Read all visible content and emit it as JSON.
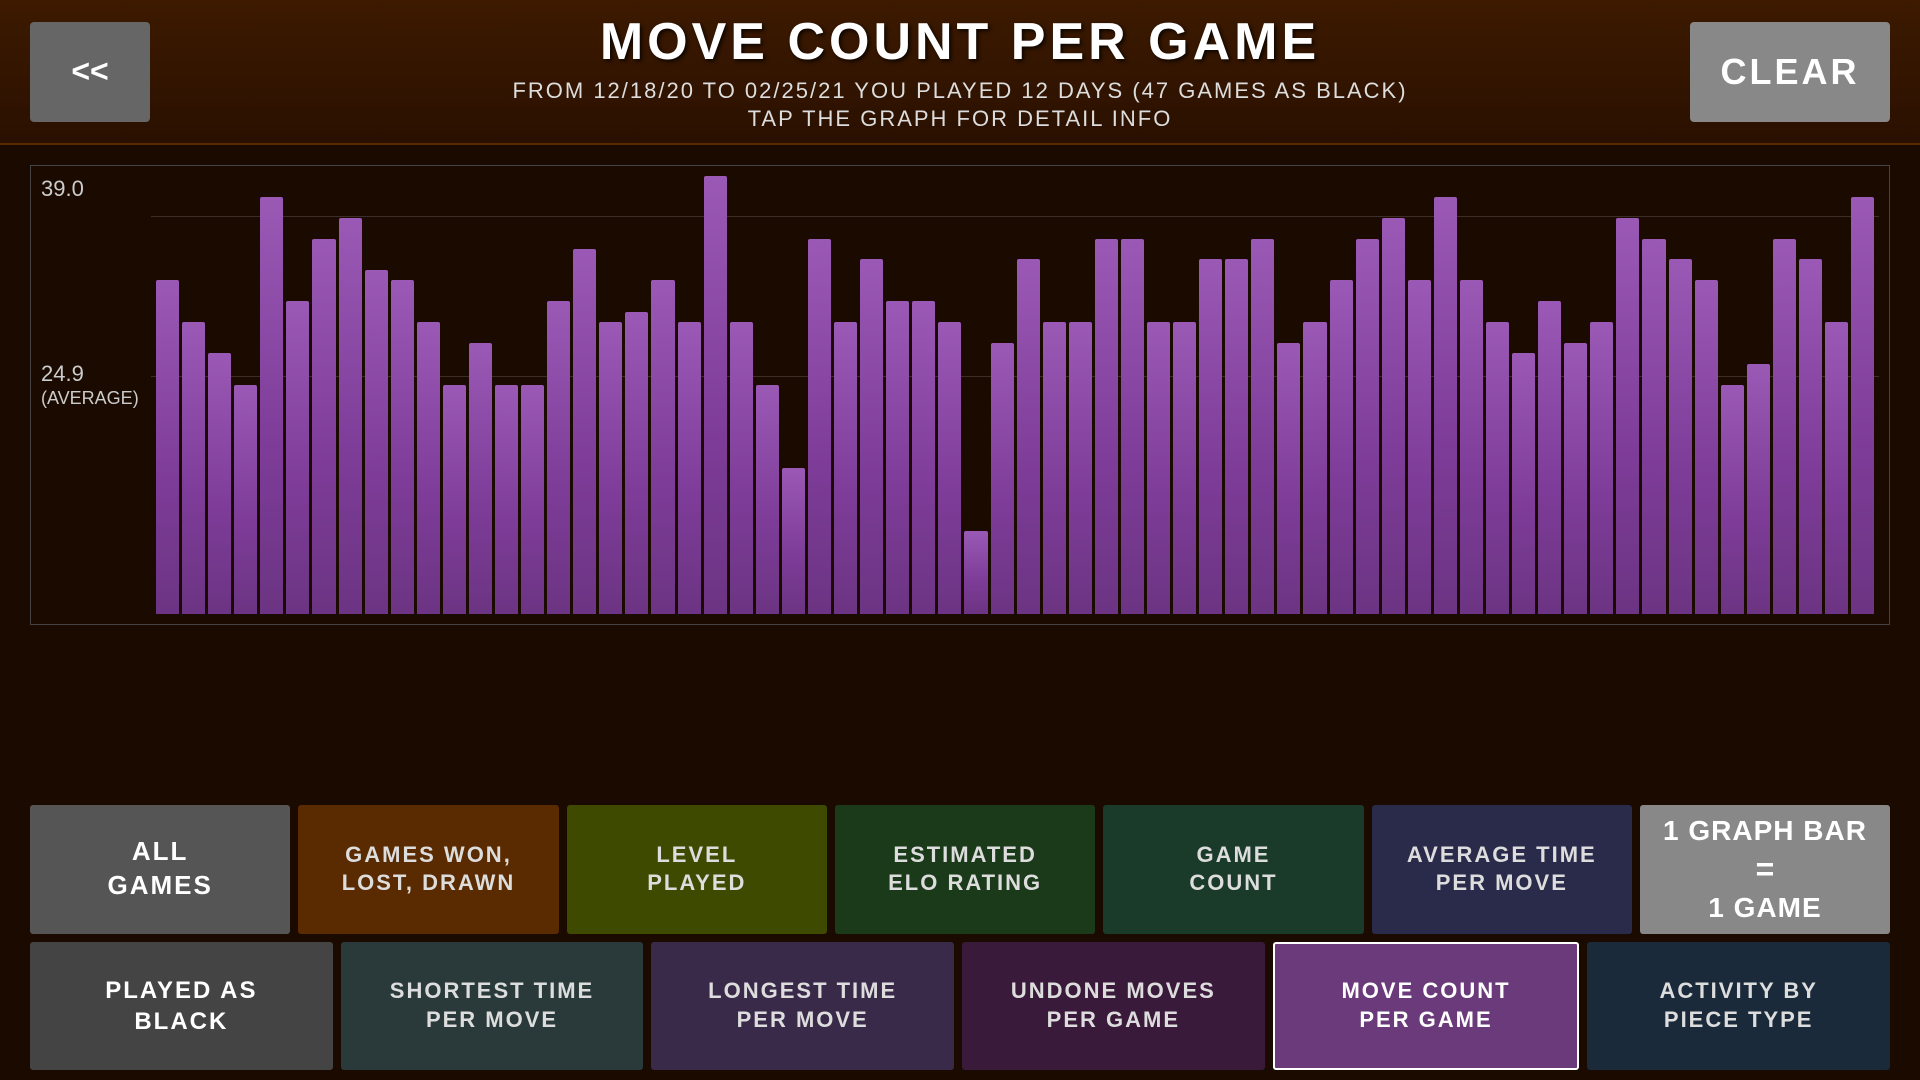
{
  "header": {
    "title": "MOVE COUNT PER GAME",
    "subtitle": "FROM 12/18/20 TO 02/25/21 YOU PLAYED 12 DAYS (47 GAMES AS BLACK)",
    "tap_hint": "TAP THE GRAPH FOR DETAIL INFO",
    "back_label": "<<",
    "clear_label": "CLEAR"
  },
  "chart": {
    "y_max": "39.0",
    "y_avg": "24.9",
    "y_avg_label": "(AVERAGE)",
    "bars": [
      32,
      28,
      25,
      22,
      40,
      30,
      36,
      38,
      33,
      32,
      28,
      22,
      26,
      22,
      22,
      30,
      35,
      28,
      29,
      32,
      28,
      42,
      28,
      22,
      14,
      36,
      28,
      34,
      30,
      30,
      28,
      8,
      26,
      34,
      28,
      28,
      36,
      36,
      28,
      28,
      34,
      34,
      36,
      26,
      28,
      32,
      36,
      38,
      32,
      40,
      32,
      28,
      25,
      30,
      26,
      28,
      38,
      36,
      34,
      32,
      22,
      24,
      36,
      34,
      28,
      40
    ]
  },
  "buttons": {
    "row1": [
      {
        "id": "all-games",
        "label": "ALL\nGAMES",
        "style": "btn-all-games"
      },
      {
        "id": "games-won",
        "label": "GAMES WON,\nLOST, DRAWN",
        "style": "btn-games-won"
      },
      {
        "id": "level-played",
        "label": "LEVEL\nPLAYED",
        "style": "btn-level"
      },
      {
        "id": "estimated-elo",
        "label": "ESTIMATED\nELO RATING",
        "style": "btn-elo"
      },
      {
        "id": "game-count",
        "label": "GAME\nCOUNT",
        "style": "btn-game-count"
      },
      {
        "id": "avg-time",
        "label": "AVERAGE TIME\nPER MOVE",
        "style": "btn-avg-time"
      }
    ],
    "row2": [
      {
        "id": "played-as-black",
        "label": "PLAYED AS\nBLACK",
        "style": "btn-played-as"
      },
      {
        "id": "shortest-time",
        "label": "SHORTEST TIME\nPER MOVE",
        "style": "btn-shortest"
      },
      {
        "id": "longest-time",
        "label": "LONGEST TIME\nPER MOVE",
        "style": "btn-longest"
      },
      {
        "id": "undone-moves",
        "label": "UNDONE MOVES\nPER GAME",
        "style": "btn-undone"
      },
      {
        "id": "move-count",
        "label": "MOVE COUNT\nPER GAME",
        "style": "btn-move-count"
      },
      {
        "id": "activity",
        "label": "ACTIVITY BY\nPIECE TYPE",
        "style": "btn-activity"
      }
    ],
    "graph_bar": {
      "line1": "1 GRAPH BAR",
      "equals": "=",
      "line2": "1 GAME"
    }
  }
}
